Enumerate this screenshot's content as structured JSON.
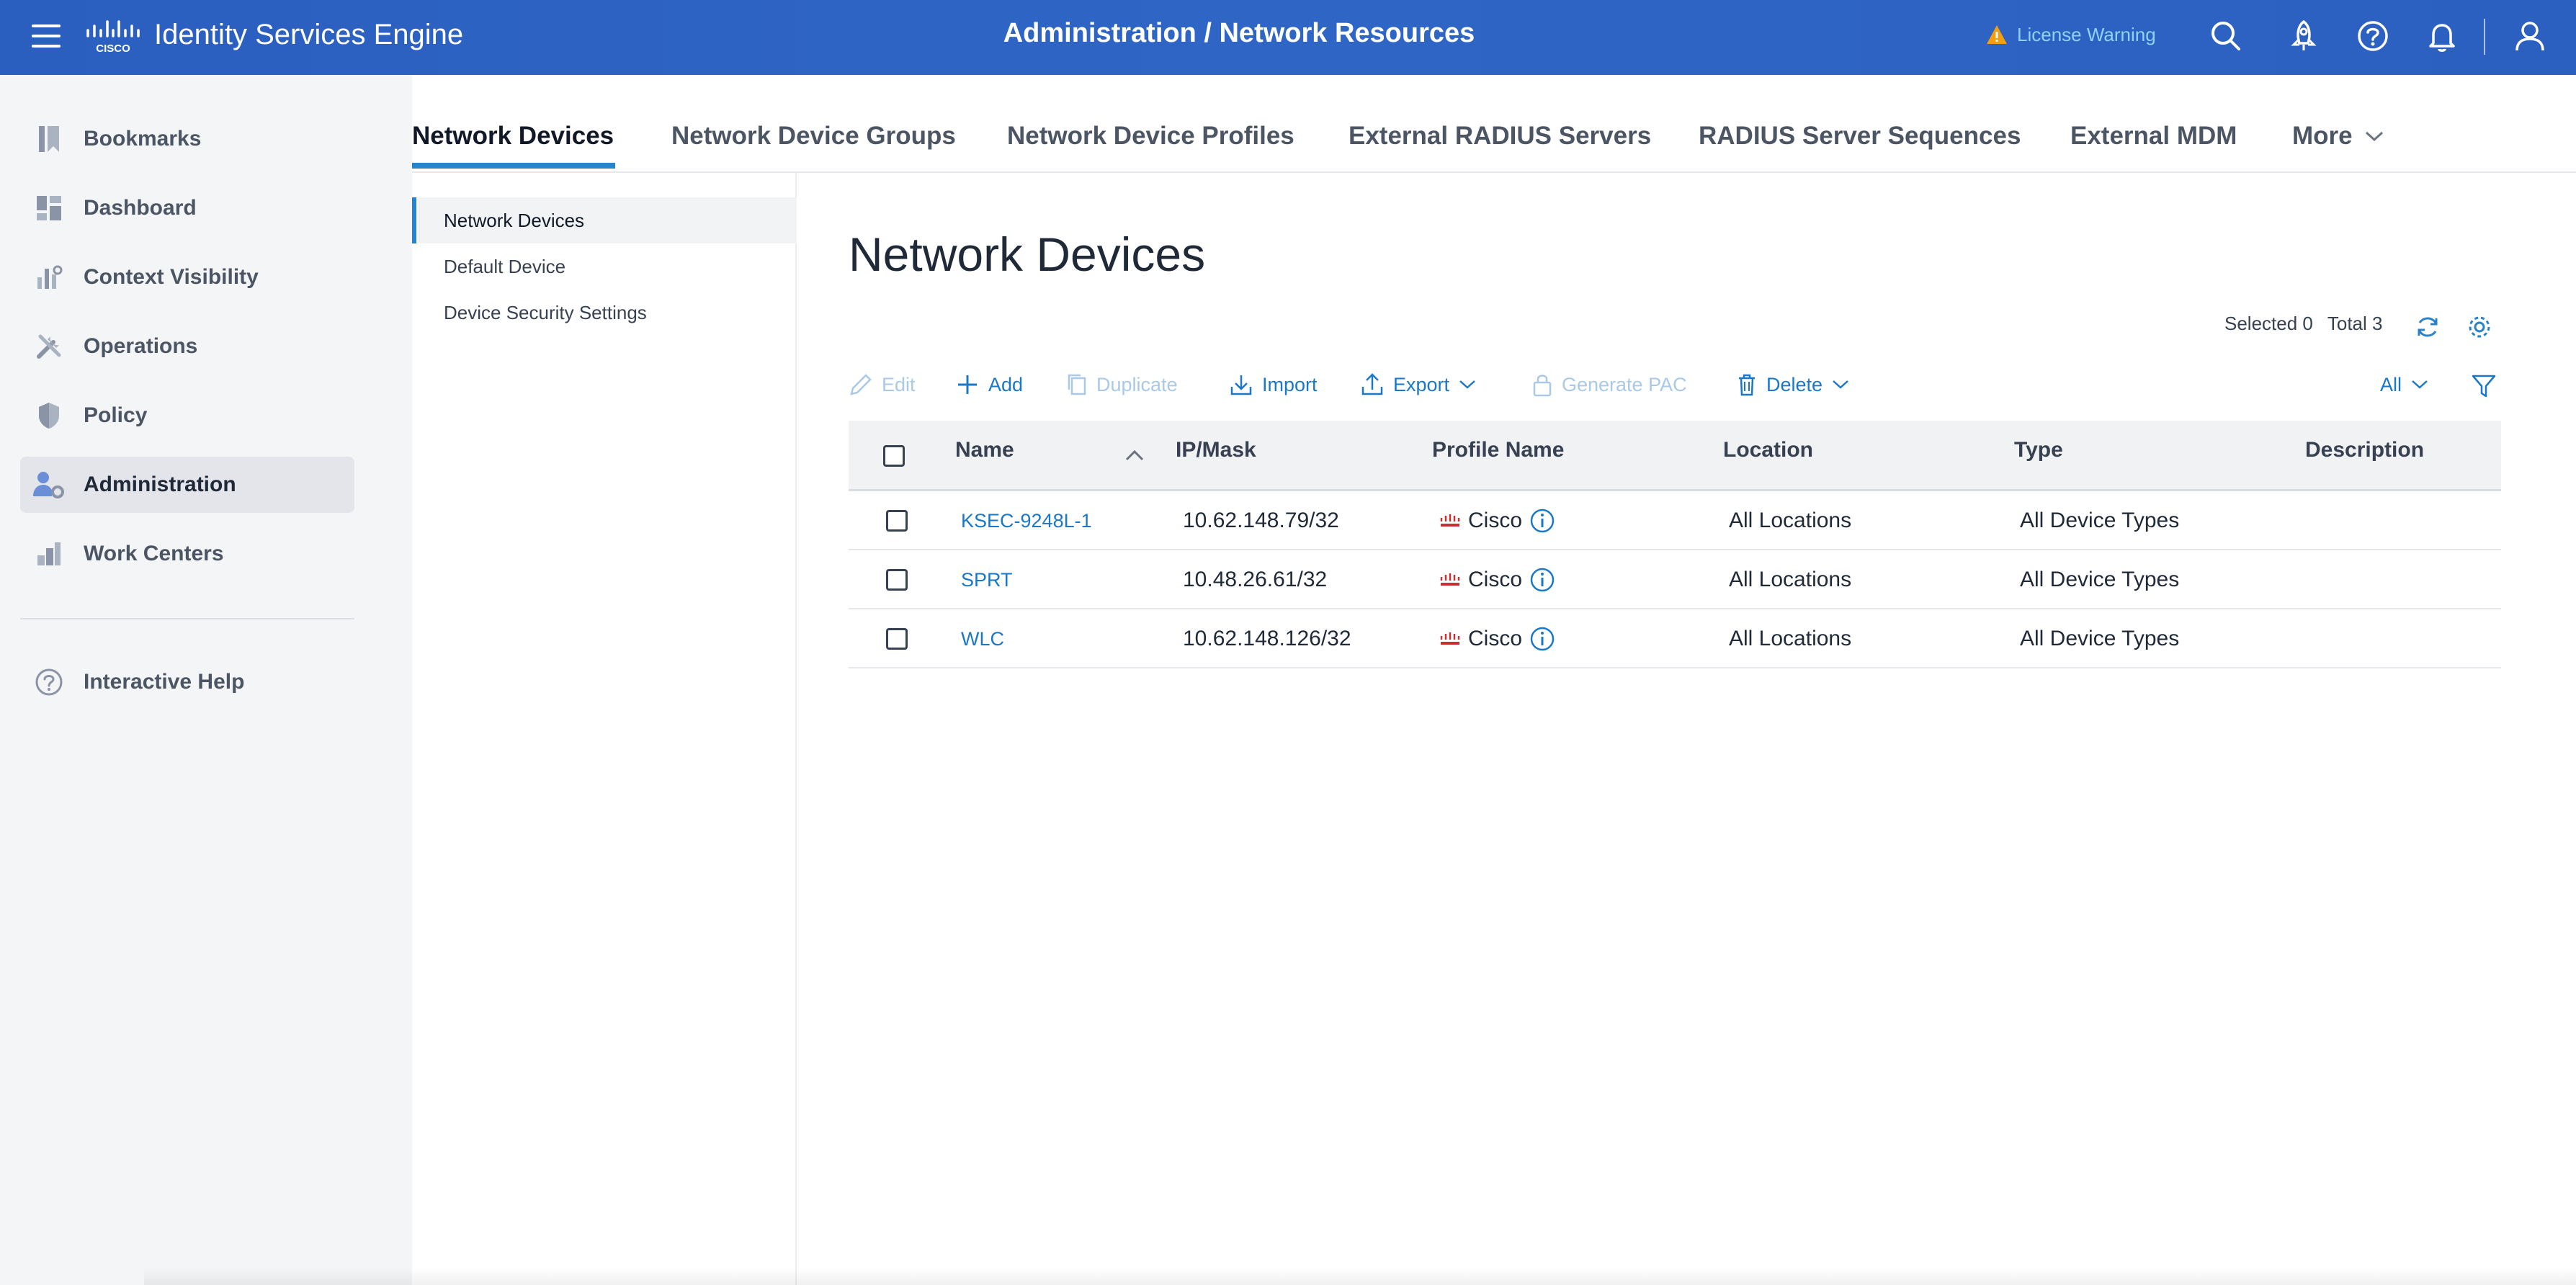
{
  "header": {
    "product_title": "Identity Services Engine",
    "page_heading": "Administration / Network Resources",
    "license_warning": "License Warning",
    "colors": {
      "background": "#2f66c6",
      "warning": "#f59e0b",
      "license_text": "#8fd2f5"
    },
    "icons": [
      "menu-icon",
      "cisco-logo",
      "search-icon",
      "rocket-icon",
      "help-icon",
      "bell-icon",
      "user-icon"
    ]
  },
  "sidebar": {
    "items": [
      {
        "label": "Bookmarks",
        "icon": "bookmark-icon"
      },
      {
        "label": "Dashboard",
        "icon": "dashboard-icon"
      },
      {
        "label": "Context Visibility",
        "icon": "context-visibility-icon"
      },
      {
        "label": "Operations",
        "icon": "operations-icon"
      },
      {
        "label": "Policy",
        "icon": "shield-icon"
      },
      {
        "label": "Administration",
        "icon": "admin-user-gear-icon",
        "active": true
      },
      {
        "label": "Work Centers",
        "icon": "work-centers-icon"
      }
    ],
    "help": {
      "label": "Interactive Help",
      "icon": "help-icon"
    }
  },
  "tabs": [
    {
      "label": "Network Devices",
      "active": true
    },
    {
      "label": "Network Device Groups"
    },
    {
      "label": "Network Device Profiles"
    },
    {
      "label": "External RADIUS Servers"
    },
    {
      "label": "RADIUS Server Sequences"
    },
    {
      "label": "External MDM"
    },
    {
      "label": "More"
    }
  ],
  "subnav": [
    {
      "label": "Network Devices",
      "active": true
    },
    {
      "label": "Default Device"
    },
    {
      "label": "Device Security Settings"
    }
  ],
  "content": {
    "title": "Network Devices",
    "selected": "Selected 0",
    "total": "Total 3",
    "filter_all": "All"
  },
  "toolbar": {
    "edit": "Edit",
    "add": "Add",
    "duplicate": "Duplicate",
    "import": "Import",
    "export": "Export",
    "generate_pac": "Generate PAC",
    "delete": "Delete"
  },
  "table": {
    "columns": [
      "Name",
      "IP/Mask",
      "Profile Name",
      "Location",
      "Type",
      "Description"
    ],
    "rows": [
      {
        "name": "KSEC-9248L-1",
        "ip": "10.62.148.79/32",
        "profile": "Cisco",
        "location": "All Locations",
        "type": "All Device Types",
        "description": ""
      },
      {
        "name": "SPRT",
        "ip": "10.48.26.61/32",
        "profile": "Cisco",
        "location": "All Locations",
        "type": "All Device Types",
        "description": ""
      },
      {
        "name": "WLC",
        "ip": "10.62.148.126/32",
        "profile": "Cisco",
        "location": "All Locations",
        "type": "All Device Types",
        "description": ""
      }
    ]
  }
}
